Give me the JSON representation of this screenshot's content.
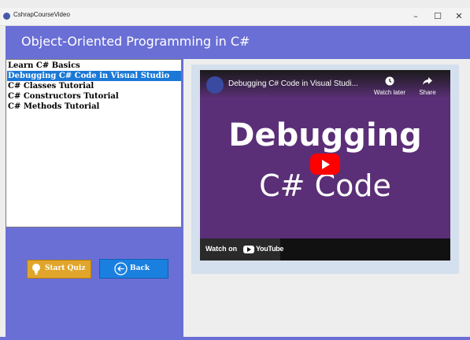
{
  "window": {
    "app_title": "CshrapCourseVideo",
    "minimize_glyph": "–",
    "maximize_glyph": "☐",
    "close_glyph": "✕"
  },
  "header": {
    "title": "Object-Oriented Programming in C#"
  },
  "course_list": {
    "items": [
      {
        "label": "Learn C# Basics",
        "selected": false
      },
      {
        "label": "Debugging C# Code in Visual Studio",
        "selected": true
      },
      {
        "label": "C# Classes Tutorial",
        "selected": false
      },
      {
        "label": "C# Constructors Tutorial",
        "selected": false
      },
      {
        "label": "C# Methods Tutorial",
        "selected": false
      }
    ]
  },
  "buttons": {
    "start_quiz": "Start Quiz",
    "back": "Back"
  },
  "video": {
    "title": "Debugging C# Code in Visual Studi...",
    "watch_later": "Watch later",
    "share": "Share",
    "thumbnail_line1": "Debugging",
    "thumbnail_line2": "C# Code",
    "watch_on": "Watch on",
    "platform": "YouTube"
  },
  "colors": {
    "accent": "#6a6fd6",
    "selected": "#1a78d6",
    "quiz_button": "#e0a52a",
    "back_button": "#1a80e0",
    "thumbnail_bg": "#5a2f77",
    "play_red": "#ff0000"
  },
  "icons": {
    "app": "app-icon",
    "quiz": "lightbulb-icon",
    "back": "arrow-left-circle-icon",
    "watch_later": "clock-icon",
    "share": "share-arrow-icon",
    "play": "play-icon"
  }
}
